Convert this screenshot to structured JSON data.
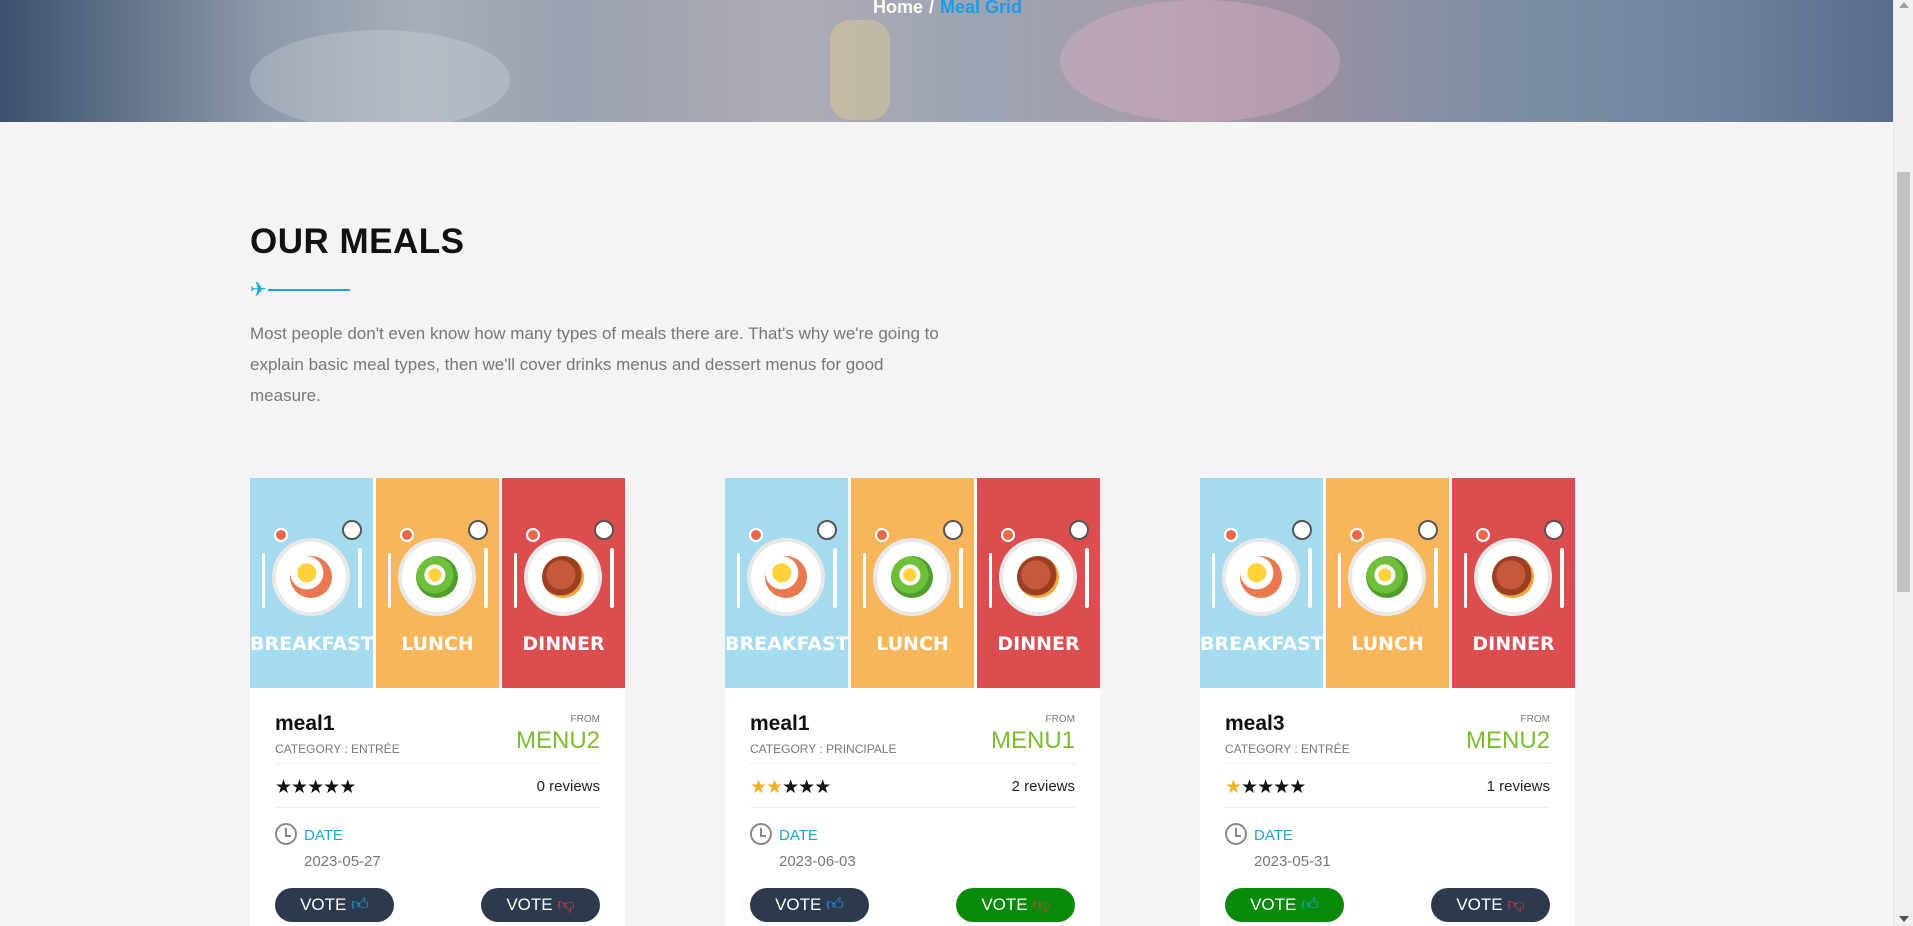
{
  "breadcrumb": {
    "home": "Home",
    "separator": "/",
    "current": "Meal Grid"
  },
  "section": {
    "title": "OUR MEALS",
    "divider_icon": "plane-icon",
    "intro": "Most people don't even know how many types of meals there are. That's why we're going to explain basic meal types, then we'll cover drinks menus and dessert menus for good measure."
  },
  "image_panels": [
    "BREAKFAST",
    "LUNCH",
    "DINNER"
  ],
  "meals": [
    {
      "name": "meal1",
      "category": "CATEGORY : ENTRÉE",
      "from_label": "FROM",
      "menu": "MENU2",
      "rating": 0,
      "reviews": "0 reviews",
      "date_label": "DATE",
      "date": "2023-05-27",
      "vote_up_label": "VOTE",
      "vote_down_label": "VOTE",
      "vote_up_active": false,
      "vote_down_active": false
    },
    {
      "name": "meal1",
      "category": "CATEGORY : PRINCIPALE",
      "from_label": "FROM",
      "menu": "MENU1",
      "rating": 2,
      "reviews": "2 reviews",
      "date_label": "DATE",
      "date": "2023-06-03",
      "vote_up_label": "VOTE",
      "vote_down_label": "VOTE",
      "vote_up_active": false,
      "vote_down_active": true
    },
    {
      "name": "meal3",
      "category": "CATEGORY : ENTRÉE",
      "from_label": "FROM",
      "menu": "MENU2",
      "rating": 1,
      "reviews": "1 reviews",
      "date_label": "DATE",
      "date": "2023-05-31",
      "vote_up_label": "VOTE",
      "vote_down_label": "VOTE",
      "vote_up_active": true,
      "vote_down_active": false
    }
  ],
  "colors": {
    "accent": "#1aa6d9",
    "menu": "#7bbd2e",
    "vote_default": "#2d3a4e",
    "vote_active": "#0a8a0a",
    "star_on": "#f4b12a"
  }
}
